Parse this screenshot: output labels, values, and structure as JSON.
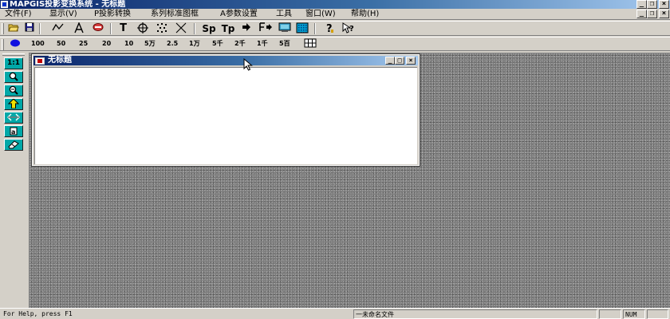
{
  "window": {
    "title": "MAPGIS投影变换系统 - 无标题",
    "minimize": "_",
    "maximize": "□",
    "close": "×",
    "restore": "❐"
  },
  "menu": {
    "items": [
      "文件(F)",
      "显示(V)",
      "P投影转换",
      "系列标准图框",
      "A参数设置",
      "工具",
      "窗口(W)",
      "帮助(H)"
    ]
  },
  "toolbar1": {
    "buttons": [
      "open-icon",
      "save-icon",
      "line-icon",
      "text-icon",
      "area-icon",
      "text-tool-icon",
      "crosshair-icon",
      "points-icon",
      "cross-icon"
    ],
    "text_buttons": [
      "T",
      "Sp",
      "Tp",
      "F"
    ],
    "help": "?",
    "context_help": "?"
  },
  "toolbar2": {
    "scales": [
      "100",
      "50",
      "25",
      "20",
      "10",
      "5万",
      "2.5",
      "1万",
      "5千",
      "2千",
      "1千",
      "5百"
    ]
  },
  "lefttoolbar": {
    "one_to_one": "1:1"
  },
  "child_window": {
    "title": "无标题",
    "minimize": "_",
    "maximize": "□",
    "close": "×"
  },
  "statusbar": {
    "help": "For Help, press F1",
    "filename": "一未命名文件",
    "num": "NUM"
  },
  "colors": {
    "titlebar_start": "#0a246a",
    "titlebar_end": "#a6caf0",
    "face": "#d4d0c8",
    "left_buttons": "#00a8a8"
  }
}
